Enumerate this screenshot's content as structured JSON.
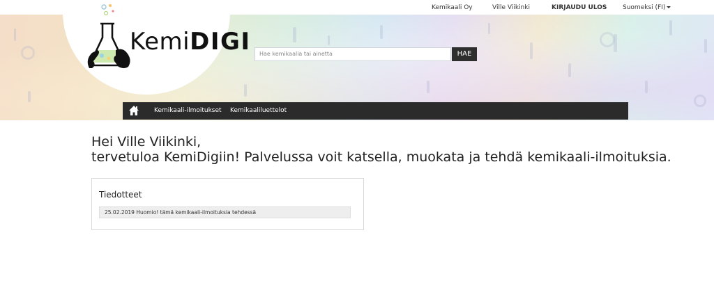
{
  "topbar": {
    "company": "Kemikaali Oy",
    "user": "Ville Viikinki",
    "logout": "KIRJAUDU ULOS",
    "language": "Suomeksi (FI)"
  },
  "logo": {
    "text_light": "Kemi",
    "text_bold": "DIGI"
  },
  "search": {
    "placeholder": "Hae kemikaalia tai ainetta",
    "button": "HAE"
  },
  "nav": {
    "home_icon": "home-icon",
    "items": [
      "Kemikaali-ilmoitukset",
      "Kemikaaliluettelot"
    ]
  },
  "welcome": {
    "line1": "Hei Ville Viikinki,",
    "line2": "tervetuloa KemiDigiin! Palvelussa voit katsella, muokata ja tehdä kemikaali-ilmoituksia."
  },
  "announcements": {
    "title": "Tiedotteet",
    "items": [
      {
        "text": "25.02.2019 Huomio! tämä kemikaali-ilmoituksia tehdessä"
      }
    ]
  }
}
